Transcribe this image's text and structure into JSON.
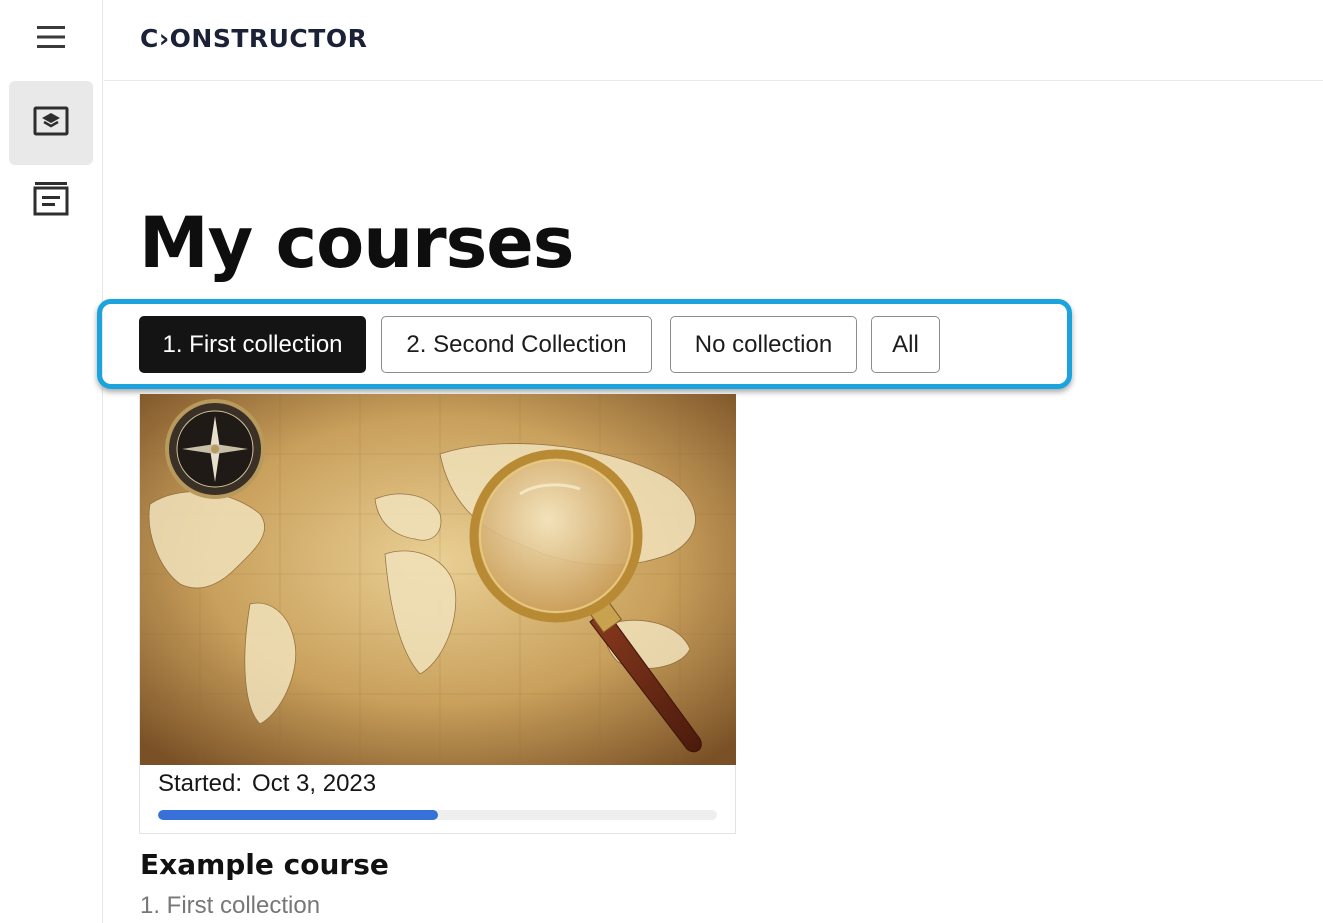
{
  "app": {
    "logo_text": "C›ONSTRUCTOR"
  },
  "rail": {
    "menu_icon": "hamburger-menu-icon",
    "courses_icon": "course-stack-icon",
    "archive_icon": "archive-box-icon",
    "active_item": "courses"
  },
  "page": {
    "title": "My courses"
  },
  "filters": {
    "highlight_color": "#1aa3dc",
    "chips": [
      {
        "label": "1. First collection",
        "active": true
      },
      {
        "label": "2. Second Collection",
        "active": false
      },
      {
        "label": "No collection",
        "active": false
      },
      {
        "label": "All",
        "active": false
      }
    ]
  },
  "course_card": {
    "image": "world-map-with-compass-and-magnifying-glass",
    "started_label": "Started:",
    "started_date": "Oct 3, 2023",
    "progress_fraction": 0.5,
    "progress_color": "#3670d8",
    "title": "Example course",
    "collection": "1. First collection"
  }
}
